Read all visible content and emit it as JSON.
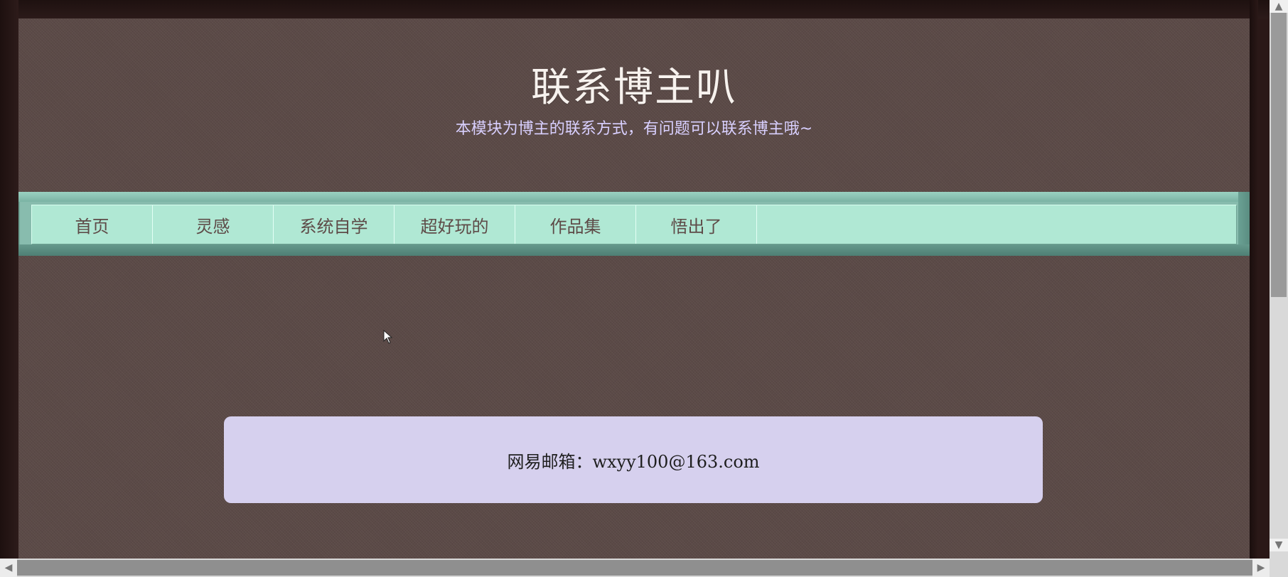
{
  "header": {
    "title": "联系博主叭",
    "subtitle": "本模块为博主的联系方式，有问题可以联系博主哦~"
  },
  "nav": {
    "items": [
      {
        "label": "首页"
      },
      {
        "label": "灵感"
      },
      {
        "label": "系统自学"
      },
      {
        "label": "超好玩的"
      },
      {
        "label": "作品集"
      },
      {
        "label": "悟出了"
      }
    ]
  },
  "contact": {
    "text": "网易邮箱：wxyy100@163.com"
  },
  "scrollbars": {
    "vertical_up_icon": "chevron-up-icon",
    "vertical_down_icon": "chevron-down-icon",
    "horizontal_left_icon": "chevron-left-icon",
    "horizontal_right_icon": "chevron-right-icon"
  },
  "colors": {
    "page_background": "#5b4a47",
    "title": "#f7f2ee",
    "subtitle": "#d9d0ff",
    "nav_background": "#b0e8d4",
    "nav_text": "#5e4b48",
    "contact_background": "#d6d0ee"
  }
}
